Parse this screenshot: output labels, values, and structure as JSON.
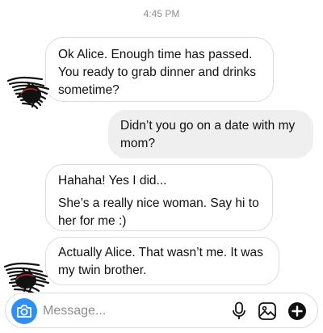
{
  "thread": {
    "timestamp": "4:45 PM",
    "messages": [
      {
        "direction": "received",
        "lines": [
          "Ok Alice. Enough time has passed.",
          "You ready to grab dinner and drinks",
          "sometime?"
        ]
      },
      {
        "direction": "sent",
        "lines": [
          "Didn’t you go on a date with my",
          "mom?"
        ]
      },
      {
        "direction": "received",
        "lines": [
          "Hahaha! Yes I did...",
          "She’s a really nice woman. Say hi to",
          "her for me :)"
        ]
      },
      {
        "direction": "received",
        "lines": [
          "Actually Alice. That wasn’t me. It was",
          "my twin brother."
        ]
      }
    ]
  },
  "composer": {
    "placeholder": "Message...",
    "camera_icon": "camera-icon",
    "mic_icon": "microphone-icon",
    "gallery_icon": "gallery-icon",
    "plus_icon": "plus-icon",
    "accent_color": "#2f8ff3"
  },
  "colors": {
    "received_bubble_border": "#dcdcdc",
    "sent_bubble_bg": "#efefef",
    "timestamp_text": "#8e8e8e"
  }
}
